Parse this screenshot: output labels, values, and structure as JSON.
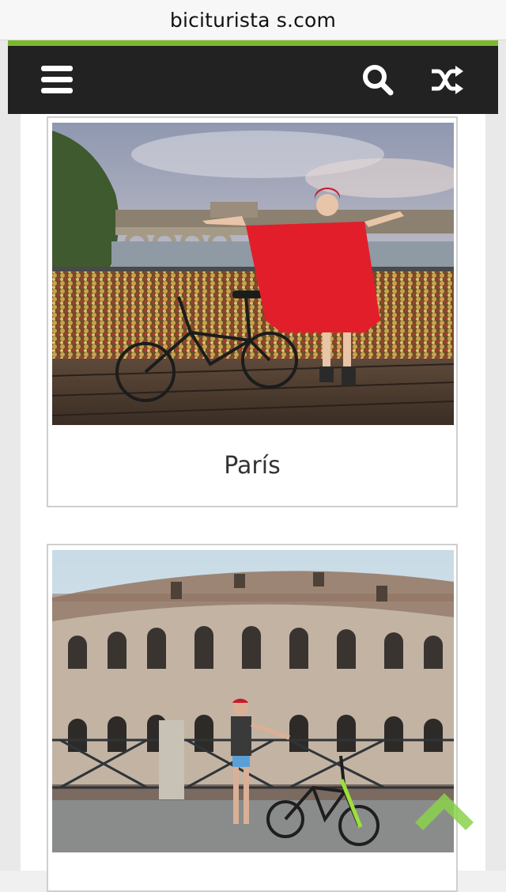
{
  "browser": {
    "domain": "biciturista s.com"
  },
  "header": {
    "icons": [
      "menu-icon",
      "search-icon",
      "shuffle-icon"
    ],
    "accent_color": "#7cb82f",
    "bar_color": "#222222"
  },
  "cards": [
    {
      "title": "París",
      "photo": "Paris lock bridge cyclist photo"
    },
    {
      "title": "",
      "photo": "Rome Colosseum cyclist photo"
    }
  ],
  "back_to_top": {
    "icon": "chevron-up-icon",
    "color": "#8bd14a"
  }
}
